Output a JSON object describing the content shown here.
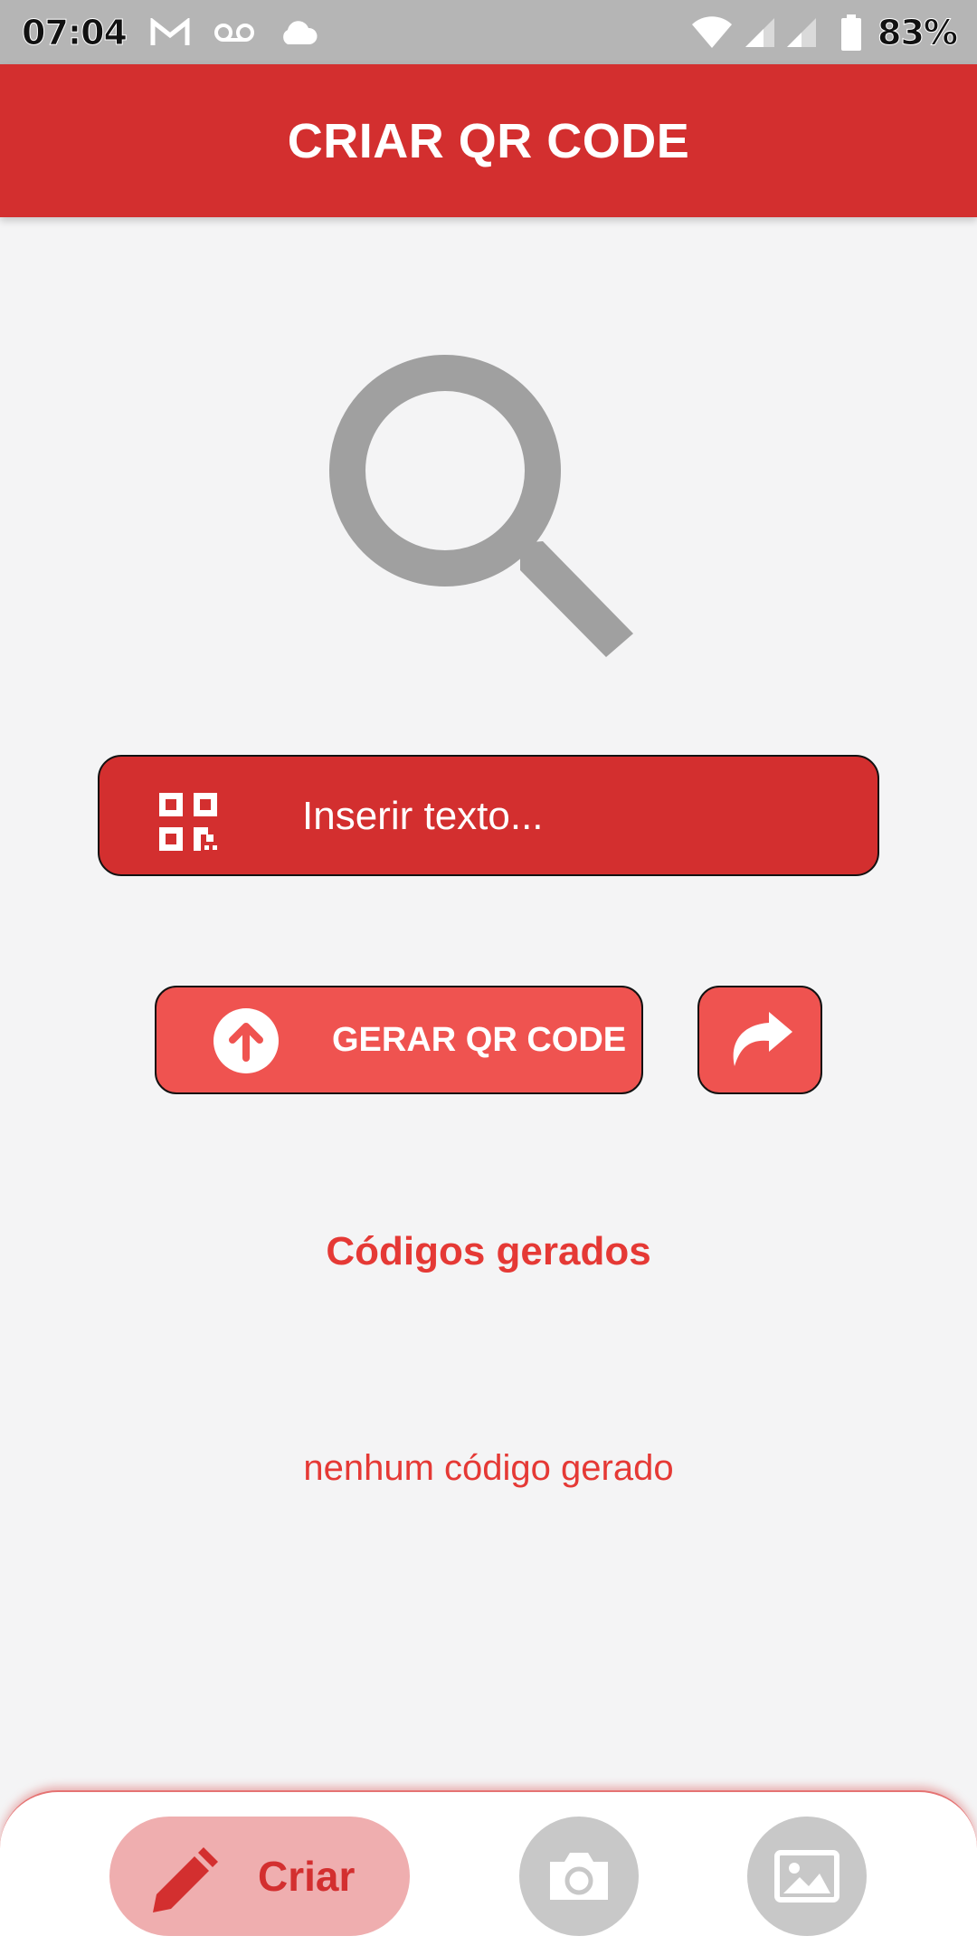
{
  "status_bar": {
    "time": "07:04",
    "battery": "83%"
  },
  "app_bar": {
    "title": "CRIAR QR CODE"
  },
  "input": {
    "placeholder": "Inserir texto...",
    "value": ""
  },
  "buttons": {
    "generate_label": "GERAR QR CODE"
  },
  "section": {
    "title": "Códigos gerados",
    "empty_message": "nenhum código gerado"
  },
  "bottom_nav": {
    "create_label": "Criar"
  },
  "colors": {
    "primary": "#d32f2f",
    "button": "#ef5350",
    "background": "#f4f4f5",
    "nav_active": "#efaeaf",
    "nav_inactive": "#c8c8c8"
  },
  "icons": {
    "status": [
      "gmail-icon",
      "voicemail-icon",
      "cloud-icon",
      "wifi-icon",
      "signal-icon",
      "signal-icon",
      "battery-icon"
    ],
    "main": [
      "search-icon",
      "qr-code-icon",
      "arrow-up-circle-icon",
      "share-icon"
    ],
    "nav": [
      "pencil-icon",
      "camera-icon",
      "image-icon"
    ]
  }
}
